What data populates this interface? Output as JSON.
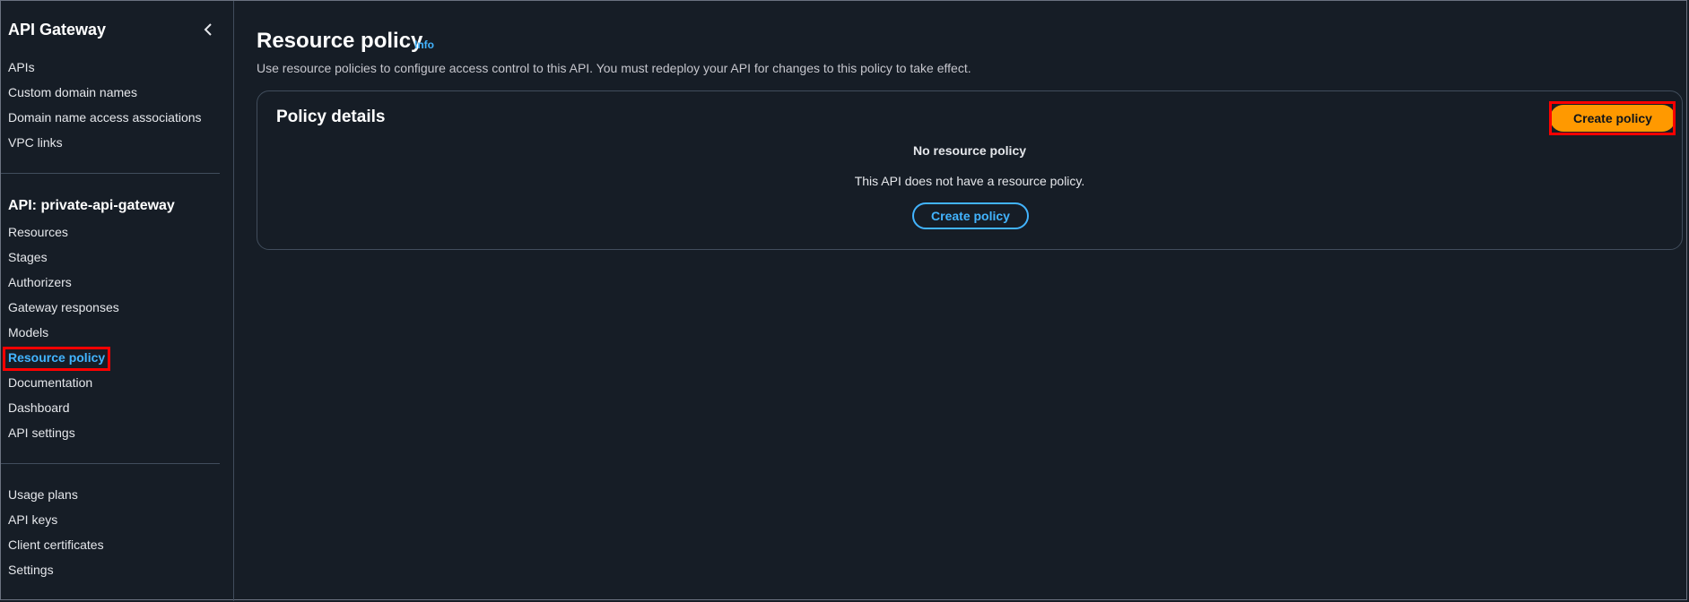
{
  "sidebar": {
    "title": "API Gateway",
    "top_items": [
      {
        "label": "APIs"
      },
      {
        "label": "Custom domain names"
      },
      {
        "label": "Domain name access associations"
      },
      {
        "label": "VPC links"
      }
    ],
    "api_section": {
      "title": "API: private-api-gateway",
      "items": [
        {
          "label": "Resources"
        },
        {
          "label": "Stages"
        },
        {
          "label": "Authorizers"
        },
        {
          "label": "Gateway responses"
        },
        {
          "label": "Models"
        },
        {
          "label": "Resource policy",
          "active": true
        },
        {
          "label": "Documentation"
        },
        {
          "label": "Dashboard"
        },
        {
          "label": "API settings"
        }
      ]
    },
    "bottom_items": [
      {
        "label": "Usage plans"
      },
      {
        "label": "API keys"
      },
      {
        "label": "Client certificates"
      },
      {
        "label": "Settings"
      }
    ]
  },
  "main": {
    "title": "Resource policy",
    "info_label": "Info",
    "description": "Use resource policies to configure access control to this API. You must redeploy your API for changes to this policy to take effect.",
    "panel": {
      "title": "Policy details",
      "primary_button": "Create policy",
      "empty_title": "No resource policy",
      "empty_description": "This API does not have a resource policy.",
      "secondary_button": "Create policy"
    }
  },
  "colors": {
    "background": "#161d26",
    "accent_link": "#42b4ff",
    "primary_button": "#ff9900",
    "highlight": "#ff0000"
  }
}
